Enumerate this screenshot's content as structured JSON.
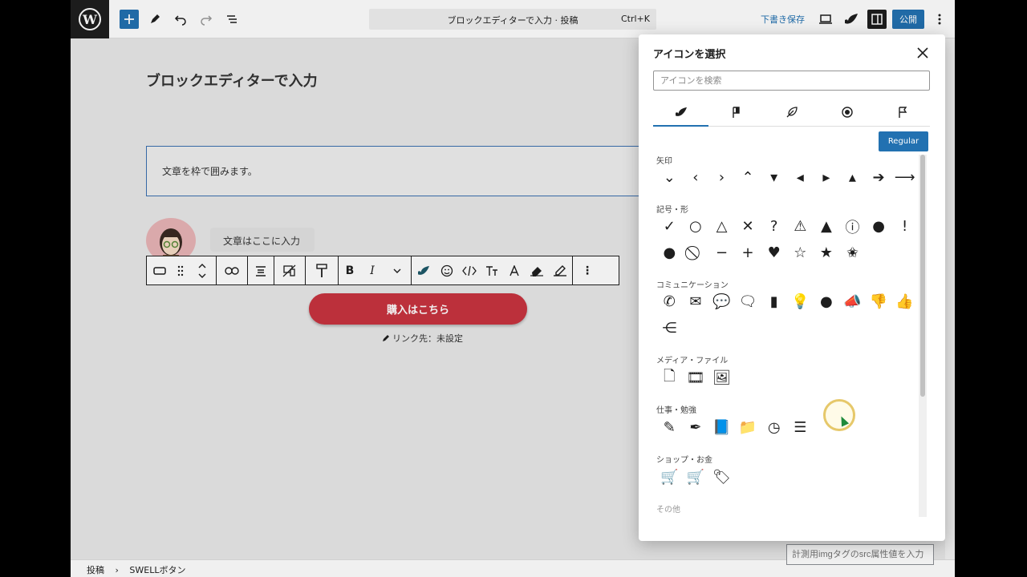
{
  "topbar": {
    "command_title": "ブロックエディターで入力 · 投稿",
    "command_shortcut": "Ctrl+K",
    "save_draft": "下書き保存",
    "publish": "公開"
  },
  "editor": {
    "post_title": "ブロックエディターで入力",
    "box_text": "文章を枠で囲みます。",
    "speech_text": "文章はここに入力",
    "button_text": "購入はこちら",
    "link_label": "リンク先：未設定"
  },
  "toolbar": {
    "bold": "B",
    "italic": "I",
    "more": "⋮"
  },
  "statusbar": {
    "crumb_1": "投稿",
    "separator": "›",
    "crumb_2": "SWELLボタン",
    "sidebar_input_placeholder": "計測用imgタグのsrc属性値を入力"
  },
  "dialog": {
    "title": "アイコンを選択",
    "search_placeholder": "アイコンを検索",
    "style_button": "Regular",
    "categories": [
      {
        "label": "矢印",
        "icons": [
          "⌄",
          "‹",
          "›",
          "⌃",
          "▾",
          "◂",
          "▸",
          "▴",
          "➔",
          "⟶"
        ]
      },
      {
        "label": "記号・形",
        "icons": [
          "✓",
          "○",
          "△",
          "✕",
          "?",
          "⚠",
          "▲",
          "ⓘ",
          "●",
          "!",
          "●",
          "⃠",
          "−",
          "+",
          "♥",
          "☆",
          "★",
          "✬"
        ]
      },
      {
        "label": "コミュニケーション",
        "icons": [
          "✆",
          "✉",
          "💬",
          "🗨",
          "▮",
          "💡",
          "●",
          "📣",
          "👎",
          "👍",
          "⋲"
        ]
      },
      {
        "label": "メディア・ファイル",
        "icons": [
          "🗋",
          "🎞",
          "🖼"
        ]
      },
      {
        "label": "仕事・勉強",
        "icons": [
          "✎",
          "✒",
          "📘",
          "📁",
          "◷",
          "☰"
        ]
      },
      {
        "label": "ショップ・お金",
        "icons": [
          "🛒",
          "🛒",
          "🏷"
        ]
      },
      {
        "label": "その他",
        "icons": []
      }
    ]
  },
  "colors": {
    "accent": "#2271b1",
    "button_red": "#c8343f"
  }
}
